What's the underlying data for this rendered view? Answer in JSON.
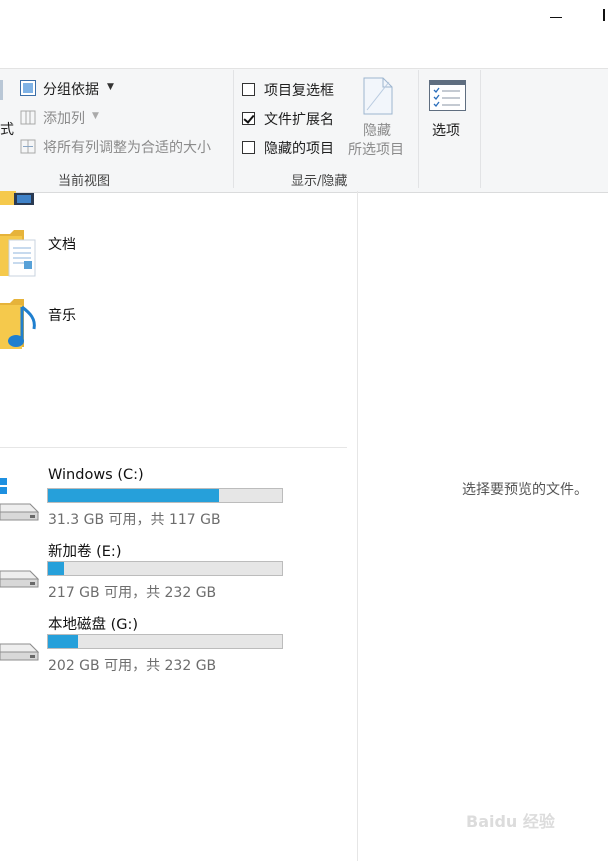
{
  "ribbon": {
    "group_layout": {
      "partial_label": "式",
      "group_by": "分组依据",
      "add_column": "添加列",
      "size_all_columns": "将所有列调整为合适的大小",
      "group_label": "当前视图"
    },
    "group_show_hide": {
      "item_checkboxes": {
        "label": "项目复选框",
        "checked": false
      },
      "file_name_extensions": {
        "label": "文件扩展名",
        "checked": true
      },
      "hidden_items": {
        "label": "隐藏的项目",
        "checked": false
      },
      "hide_selected_line1": "隐藏",
      "hide_selected_line2": "所选项目",
      "group_label": "显示/隐藏"
    },
    "options_label": "选项"
  },
  "folders": [
    {
      "name": "文档",
      "icon": "documents-folder-icon"
    },
    {
      "name": "音乐",
      "icon": "music-folder-icon"
    }
  ],
  "drives": [
    {
      "name": "Windows (C:)",
      "used_fraction": 0.73,
      "space_text": "31.3 GB 可用，共 117 GB",
      "icon": "windows-drive-icon"
    },
    {
      "name": "新加卷 (E:)",
      "used_fraction": 0.07,
      "space_text": "217 GB 可用，共 232 GB",
      "icon": "hard-drive-icon"
    },
    {
      "name": "本地磁盘 (G:)",
      "used_fraction": 0.13,
      "space_text": "202 GB 可用，共 232 GB",
      "icon": "hard-drive-icon"
    }
  ],
  "preview_message": "选择要预览的文件。",
  "watermark": "Baidu 经验",
  "colors": {
    "progress_fill": "#26a0da",
    "ribbon_bg": "#f5f6f7"
  }
}
